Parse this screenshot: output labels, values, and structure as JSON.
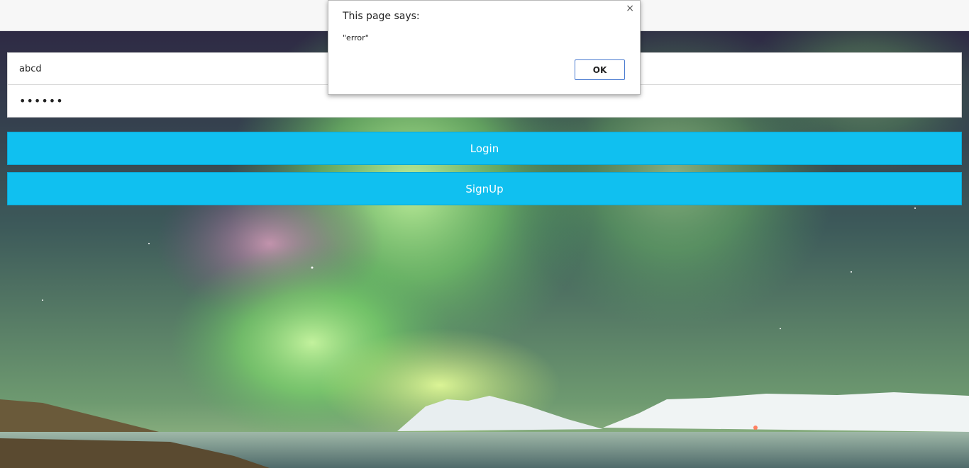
{
  "form": {
    "username_value": "abcd",
    "password_value": "••••••",
    "login_label": "Login",
    "signup_label": "SignUp"
  },
  "dialog": {
    "title": "This page says:",
    "message": "\"error\"",
    "ok_label": "OK",
    "close_glyph": "×"
  },
  "colors": {
    "button": "#10c0f0",
    "sky_top": "#2a2440",
    "aurora": "#9be870"
  }
}
